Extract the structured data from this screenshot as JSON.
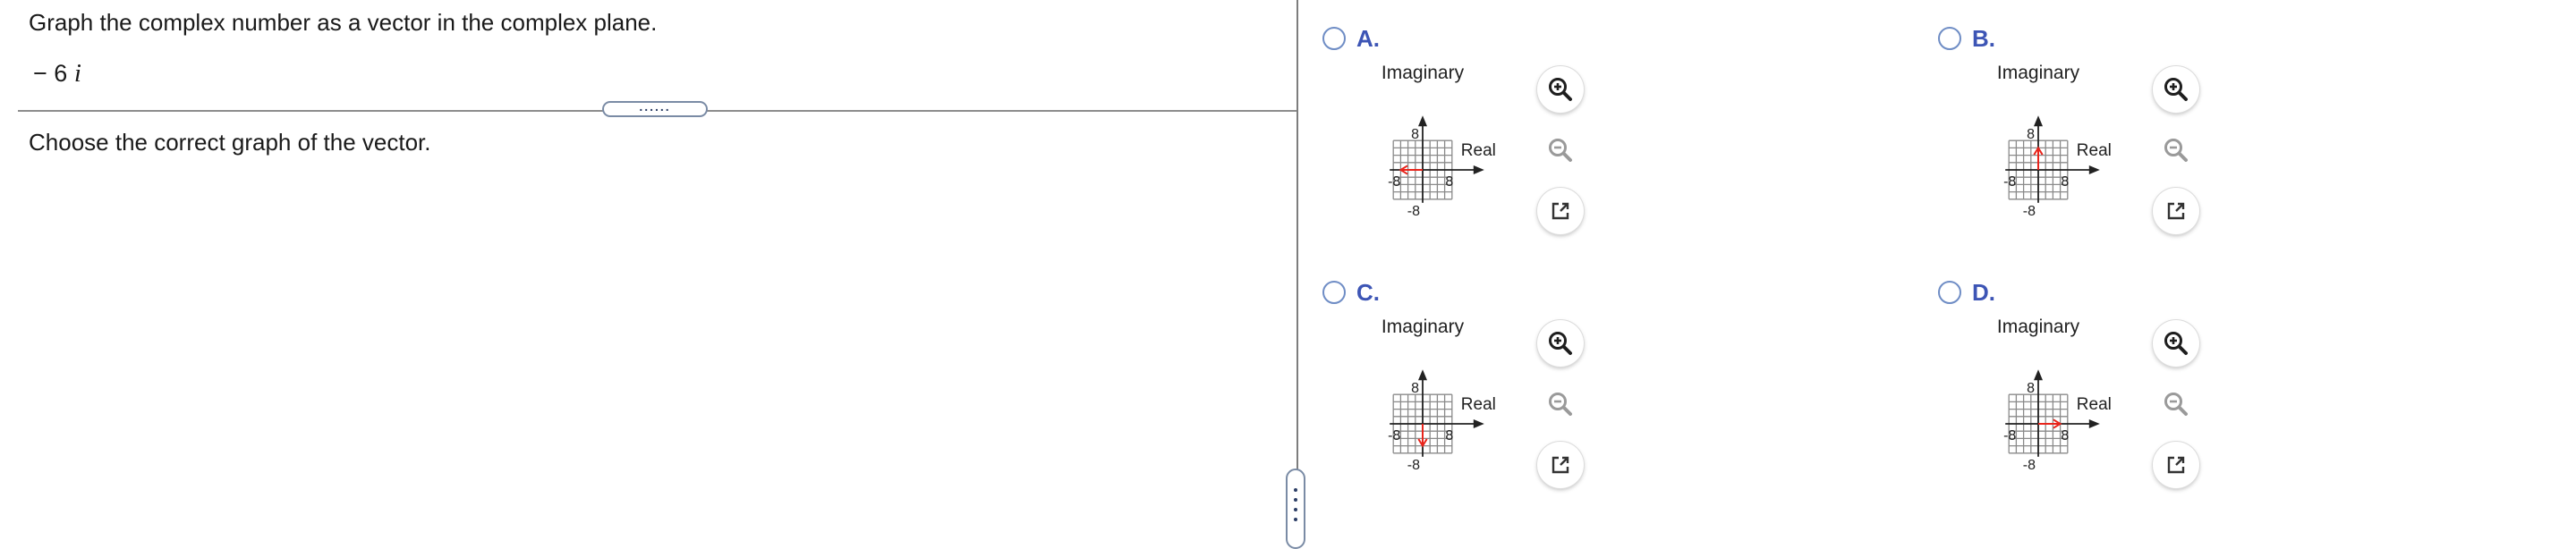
{
  "question": {
    "prompt": "Graph the complex number as a vector in the complex plane.",
    "expression_coef": "− 6",
    "expression_unit": "i",
    "instruction": "Choose the correct graph of the vector."
  },
  "splitter_dots": "......",
  "axis_labels": {
    "imaginary": "Imaginary",
    "real": "Real"
  },
  "tick_labels": {
    "pos": "8",
    "neg": "-8"
  },
  "colors": {
    "vector": "#e8241b",
    "grid": "#8a8a8a",
    "axis": "#222222",
    "letter": "#3d55b5"
  },
  "graph_range": {
    "min": -8,
    "max": 8,
    "step": 2
  },
  "options": [
    {
      "letter": "A.",
      "vector": {
        "from": [
          0,
          0
        ],
        "to": [
          -6,
          0
        ]
      }
    },
    {
      "letter": "B.",
      "vector": {
        "from": [
          0,
          0
        ],
        "to": [
          0,
          6
        ]
      }
    },
    {
      "letter": "C.",
      "vector": {
        "from": [
          0,
          0
        ],
        "to": [
          0,
          -6
        ]
      }
    },
    {
      "letter": "D.",
      "vector": {
        "from": [
          0,
          0
        ],
        "to": [
          6,
          0
        ]
      }
    }
  ],
  "tools": {
    "zoom_in": "zoom-in-icon",
    "zoom_out": "zoom-out-icon",
    "popout": "popout-icon"
  }
}
